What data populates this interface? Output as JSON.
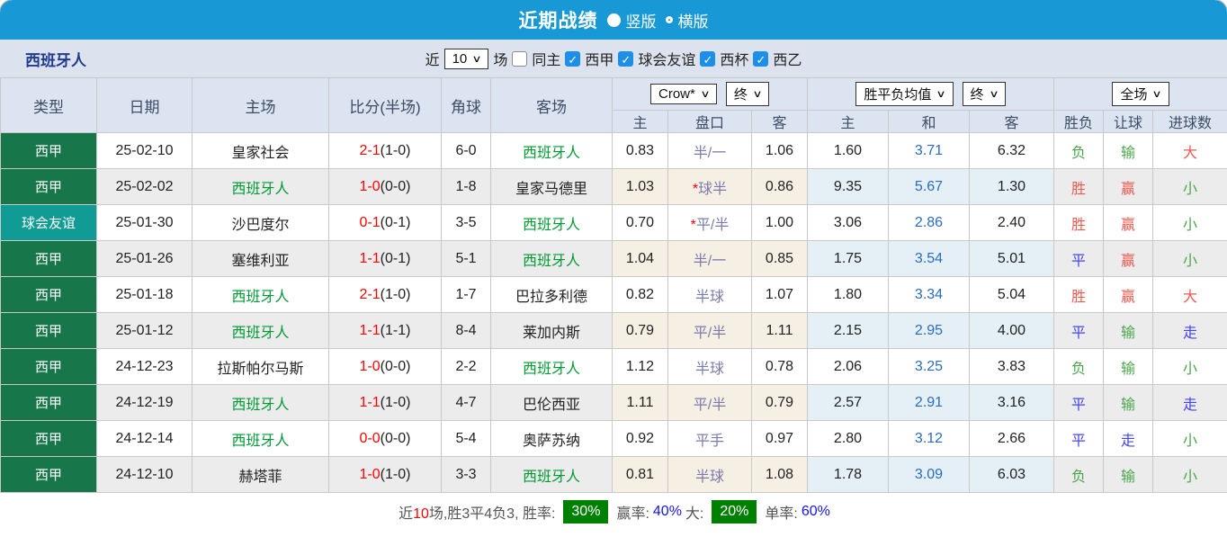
{
  "colors": {
    "accent-blue": "#1899d6",
    "laliga-green": "#17764a",
    "friendly-teal": "#109c95",
    "badge-green": "#008000",
    "team-green": "#009933",
    "result-red": "#e85c50",
    "result-green": "#4ca44c",
    "result-blue": "#4545ee",
    "draw-odds-blue": "#2b6cbf",
    "handicap-purple": "#7b7bab",
    "score-red": "#ff0000",
    "percent-blue": "#1414e8"
  },
  "topbar": {
    "title": "近期战绩",
    "radio_vertical": "竖版",
    "radio_horizontal": "横版"
  },
  "filterbar": {
    "team": "西班牙人",
    "near_label": "近",
    "count": "10",
    "games_label": "场",
    "same_home_label": "同主",
    "leagues": [
      "西甲",
      "球会友谊",
      "西杯",
      "西乙"
    ]
  },
  "table": {
    "left_headers": [
      "类型",
      "日期",
      "主场",
      "比分(半场)",
      "角球",
      "客场"
    ],
    "group1": {
      "select1": "Crow*",
      "select2": "终",
      "cols": [
        "主",
        "盘口",
        "客"
      ]
    },
    "group2": {
      "select1": "胜平负均值",
      "select2": "终",
      "cols": [
        "主",
        "和",
        "客"
      ]
    },
    "group3": {
      "select": "全场",
      "cols": [
        "胜负",
        "让球",
        "进球数"
      ]
    },
    "rows": [
      {
        "type": "西甲",
        "type_key": "laliga",
        "date": "25-02-10",
        "home": "皇家社会",
        "home_green": false,
        "score": "2-1",
        "half": "(1-0)",
        "corners": "6-0",
        "away": "西班牙人",
        "away_green": true,
        "crown_home": "0.83",
        "handicap": "半/一",
        "handicap_star": false,
        "crown_away": "1.06",
        "odds_home": "1.60",
        "odds_draw": "3.71",
        "odds_away": "6.32",
        "wdl": "负",
        "wdl_c": "green",
        "hcp_res": "输",
        "hcp_res_c": "green",
        "goals": "大",
        "goals_c": "red"
      },
      {
        "type": "西甲",
        "type_key": "laliga",
        "date": "25-02-02",
        "home": "西班牙人",
        "home_green": true,
        "score": "1-0",
        "half": "(0-0)",
        "corners": "1-8",
        "away": "皇家马德里",
        "away_green": false,
        "crown_home": "1.03",
        "handicap": "球半",
        "handicap_star": true,
        "crown_away": "0.86",
        "odds_home": "9.35",
        "odds_draw": "5.67",
        "odds_away": "1.30",
        "wdl": "胜",
        "wdl_c": "red",
        "hcp_res": "赢",
        "hcp_res_c": "red",
        "goals": "小",
        "goals_c": "green"
      },
      {
        "type": "球会友谊",
        "type_key": "friendly",
        "date": "25-01-30",
        "home": "沙巴度尔",
        "home_green": false,
        "score": "0-1",
        "half": "(0-1)",
        "corners": "3-5",
        "away": "西班牙人",
        "away_green": true,
        "crown_home": "0.70",
        "handicap": "平/半",
        "handicap_star": true,
        "crown_away": "1.00",
        "odds_home": "3.06",
        "odds_draw": "2.86",
        "odds_away": "2.40",
        "wdl": "胜",
        "wdl_c": "red",
        "hcp_res": "赢",
        "hcp_res_c": "red",
        "goals": "小",
        "goals_c": "green"
      },
      {
        "type": "西甲",
        "type_key": "laliga",
        "date": "25-01-26",
        "home": "塞维利亚",
        "home_green": false,
        "score": "1-1",
        "half": "(0-1)",
        "corners": "5-1",
        "away": "西班牙人",
        "away_green": true,
        "crown_home": "1.04",
        "handicap": "半/一",
        "handicap_star": false,
        "crown_away": "0.85",
        "odds_home": "1.75",
        "odds_draw": "3.54",
        "odds_away": "5.01",
        "wdl": "平",
        "wdl_c": "blue",
        "hcp_res": "赢",
        "hcp_res_c": "red",
        "goals": "小",
        "goals_c": "green"
      },
      {
        "type": "西甲",
        "type_key": "laliga",
        "date": "25-01-18",
        "home": "西班牙人",
        "home_green": true,
        "score": "2-1",
        "half": "(1-0)",
        "corners": "1-7",
        "away": "巴拉多利德",
        "away_green": false,
        "crown_home": "0.82",
        "handicap": "半球",
        "handicap_star": false,
        "crown_away": "1.07",
        "odds_home": "1.80",
        "odds_draw": "3.34",
        "odds_away": "5.04",
        "wdl": "胜",
        "wdl_c": "red",
        "hcp_res": "赢",
        "hcp_res_c": "red",
        "goals": "大",
        "goals_c": "red"
      },
      {
        "type": "西甲",
        "type_key": "laliga",
        "date": "25-01-12",
        "home": "西班牙人",
        "home_green": true,
        "score": "1-1",
        "half": "(1-1)",
        "corners": "8-4",
        "away": "莱加内斯",
        "away_green": false,
        "crown_home": "0.79",
        "handicap": "平/半",
        "handicap_star": false,
        "crown_away": "1.11",
        "odds_home": "2.15",
        "odds_draw": "2.95",
        "odds_away": "4.00",
        "wdl": "平",
        "wdl_c": "blue",
        "hcp_res": "输",
        "hcp_res_c": "green",
        "goals": "走",
        "goals_c": "blue"
      },
      {
        "type": "西甲",
        "type_key": "laliga",
        "date": "24-12-23",
        "home": "拉斯帕尔马斯",
        "home_green": false,
        "score": "1-0",
        "half": "(0-0)",
        "corners": "2-2",
        "away": "西班牙人",
        "away_green": true,
        "crown_home": "1.12",
        "handicap": "半球",
        "handicap_star": false,
        "crown_away": "0.78",
        "odds_home": "2.06",
        "odds_draw": "3.25",
        "odds_away": "3.83",
        "wdl": "负",
        "wdl_c": "green",
        "hcp_res": "输",
        "hcp_res_c": "green",
        "goals": "小",
        "goals_c": "green"
      },
      {
        "type": "西甲",
        "type_key": "laliga",
        "date": "24-12-19",
        "home": "西班牙人",
        "home_green": true,
        "score": "1-1",
        "half": "(1-0)",
        "corners": "4-7",
        "away": "巴伦西亚",
        "away_green": false,
        "crown_home": "1.11",
        "handicap": "平/半",
        "handicap_star": false,
        "crown_away": "0.79",
        "odds_home": "2.57",
        "odds_draw": "2.91",
        "odds_away": "3.16",
        "wdl": "平",
        "wdl_c": "blue",
        "hcp_res": "输",
        "hcp_res_c": "green",
        "goals": "走",
        "goals_c": "blue"
      },
      {
        "type": "西甲",
        "type_key": "laliga",
        "date": "24-12-14",
        "home": "西班牙人",
        "home_green": true,
        "score": "0-0",
        "half": "(0-0)",
        "corners": "5-4",
        "away": "奥萨苏纳",
        "away_green": false,
        "crown_home": "0.92",
        "handicap": "平手",
        "handicap_star": false,
        "crown_away": "0.97",
        "odds_home": "2.80",
        "odds_draw": "3.12",
        "odds_away": "2.66",
        "wdl": "平",
        "wdl_c": "blue",
        "hcp_res": "走",
        "hcp_res_c": "blue",
        "goals": "小",
        "goals_c": "green"
      },
      {
        "type": "西甲",
        "type_key": "laliga",
        "date": "24-12-10",
        "home": "赫塔菲",
        "home_green": false,
        "score": "1-0",
        "half": "(1-0)",
        "corners": "3-3",
        "away": "西班牙人",
        "away_green": true,
        "crown_home": "0.81",
        "handicap": "半球",
        "handicap_star": false,
        "crown_away": "1.08",
        "odds_home": "1.78",
        "odds_draw": "3.09",
        "odds_away": "6.03",
        "wdl": "负",
        "wdl_c": "green",
        "hcp_res": "输",
        "hcp_res_c": "green",
        "goals": "小",
        "goals_c": "green"
      }
    ]
  },
  "footer": {
    "prefix": "近",
    "count": "10",
    "mid": "场,胜3平4负3, 胜率:",
    "win_rate": "30%",
    "win_label": "赢率:",
    "win_pct": "40%",
    "big_label": "大:",
    "big_pct": "20%",
    "single_label": "单率:",
    "single_pct": "60%"
  }
}
